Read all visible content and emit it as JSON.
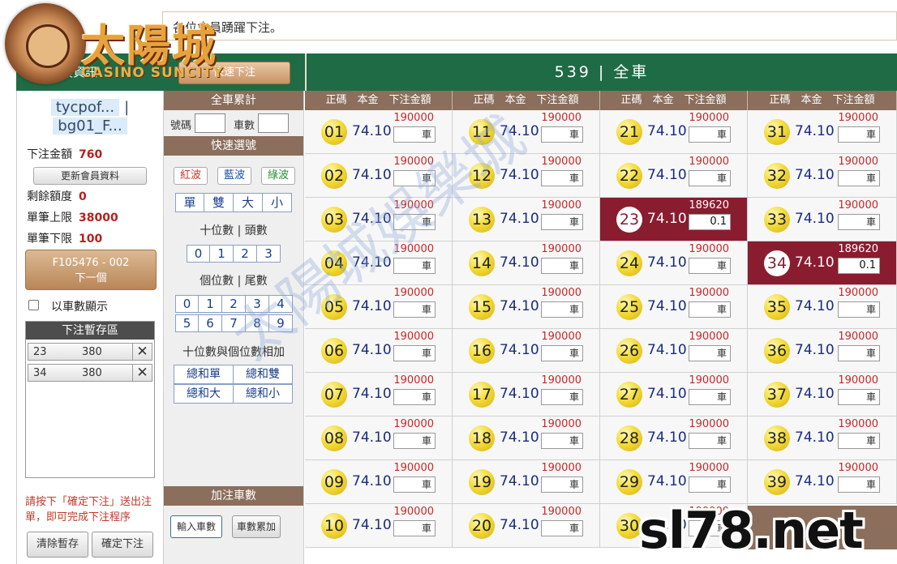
{
  "marquee": {
    "text": "各位會員踴躍下注。"
  },
  "logo": {
    "title": "太陽城",
    "subtitle": "CASINO SUNCITY"
  },
  "header": {
    "left_label": "會員資訊",
    "quick_bet": "快速下注",
    "game_title": "539 | 全車"
  },
  "user": {
    "name_1": "tycpof...",
    "separator": "|",
    "name_2": "bg01_F..."
  },
  "stats": {
    "bet_amount_label": "下注金額",
    "bet_amount": "760",
    "refresh_label": "更新會員資料",
    "remain_label": "剩餘額度",
    "remain": "0",
    "max_label": "單筆上限",
    "max": "38000",
    "min_label": "單筆下限",
    "min": "100"
  },
  "next": {
    "line1": "F105476 - 002",
    "line2": "下一個"
  },
  "show_by_count": "以車數顯示",
  "temp": {
    "title": "下注暫存區",
    "rows": [
      {
        "num": "23",
        "amount": "380"
      },
      {
        "num": "34",
        "amount": "380"
      }
    ]
  },
  "hint": "請按下「確定下注」送出注單，即可完成下注程序",
  "buttons": {
    "clear": "清除暫存",
    "confirm": "確定下注"
  },
  "middle": {
    "total_title": "全車累計",
    "num_label": "號碼",
    "count_label": "車數",
    "quick_title": "快速選號",
    "waves": [
      {
        "label": "紅波",
        "color": "#c0392b"
      },
      {
        "label": "藍波",
        "color": "#1f4ea3"
      },
      {
        "label": "綠波",
        "color": "#2e8b3a"
      }
    ],
    "parity": [
      "單",
      "雙",
      "大",
      "小"
    ],
    "tens_title": "十位數 | 頭數",
    "tens": [
      "0",
      "1",
      "2",
      "3"
    ],
    "ones_title": "個位數 | 尾數",
    "ones_row1": [
      "0",
      "1",
      "2",
      "3",
      "4"
    ],
    "ones_row2": [
      "5",
      "6",
      "7",
      "8",
      "9"
    ],
    "sum_title": "十位數與個位數相加",
    "sum": [
      "總和單",
      "總和雙",
      "總和大",
      "總和小"
    ],
    "add_title": "加注車數",
    "input_count": "輸入車數",
    "accum_count": "車數累加"
  },
  "grid": {
    "col_header": "正碼　本金　下注金額",
    "odds": "74.10",
    "limit": "190000",
    "input_placeholder": "車",
    "selected": {
      "23": {
        "limit": "189620",
        "value": "0.1"
      },
      "34": {
        "limit": "189620",
        "value": "0.1"
      }
    }
  },
  "watermark": "太陽城娛樂城",
  "site": "sl78.net"
}
